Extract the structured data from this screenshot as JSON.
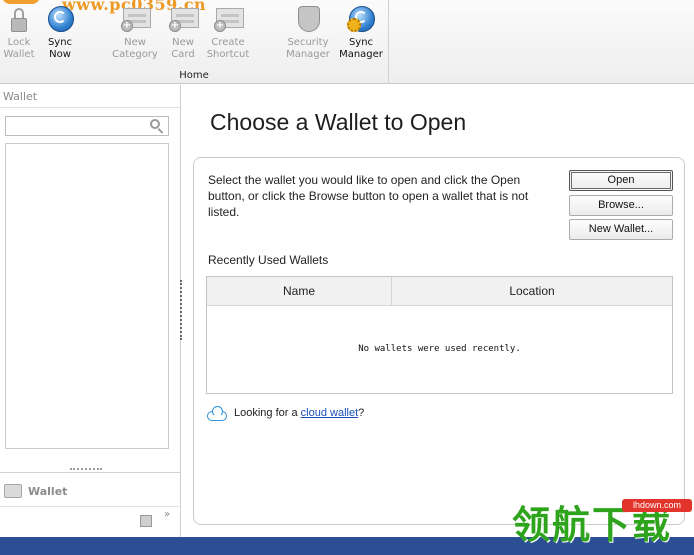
{
  "ribbon": {
    "watermark": "www.pc0359.cn",
    "buttons": [
      {
        "label_line1": "Lock",
        "label_line2": "Wallet",
        "icon": "lock-icon",
        "enabled": false
      },
      {
        "label_line1": "Sync",
        "label_line2": "Now",
        "icon": "sync-now-icon",
        "enabled": true
      },
      {
        "label_line1": "New",
        "label_line2": "Category",
        "icon": "new-category-icon",
        "enabled": false
      },
      {
        "label_line1": "New",
        "label_line2": "Card",
        "icon": "new-card-icon",
        "enabled": false
      },
      {
        "label_line1": "Create",
        "label_line2": "Shortcut",
        "icon": "create-shortcut-icon",
        "enabled": false
      },
      {
        "label_line1": "Security",
        "label_line2": "Manager",
        "icon": "security-manager-icon",
        "enabled": false
      },
      {
        "label_line1": "Sync",
        "label_line2": "Manager",
        "icon": "sync-manager-icon",
        "enabled": true
      }
    ],
    "group_label": "Home"
  },
  "left_pane": {
    "title": "Wallet",
    "search_value": "",
    "nav_item": "Wallet",
    "chevron": "»"
  },
  "main": {
    "title": "Choose a Wallet to Open",
    "instructions": "Select the wallet you would like to open and click the Open button, or click the Browse button to open a wallet that is not listed.",
    "buttons": {
      "open": "Open",
      "browse": "Browse...",
      "new_wallet": "New Wallet..."
    },
    "recent_label": "Recently Used Wallets",
    "table": {
      "columns": [
        "Name",
        "Location"
      ],
      "empty_message": "No wallets were used recently."
    },
    "cloud": {
      "prefix": "Looking for a ",
      "link": "cloud wallet",
      "suffix": "?"
    }
  },
  "watermark": {
    "text": "领航下载",
    "url": "lhdown.com"
  },
  "colors": {
    "accent": "#2f8fd8",
    "link": "#1b4fb8",
    "strip": "#2b4f92",
    "watermark_green": "#2ea41c"
  }
}
